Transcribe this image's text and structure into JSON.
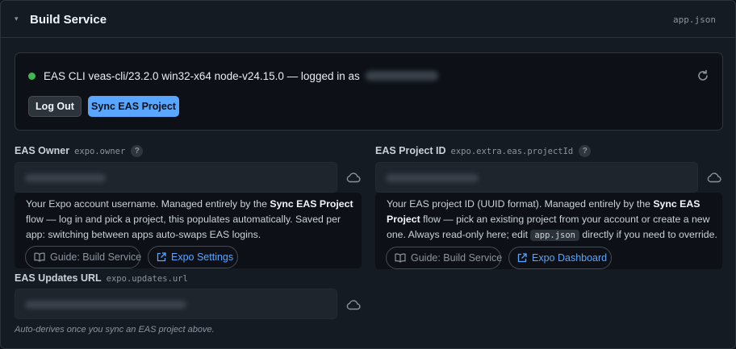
{
  "section": {
    "caret": "▾",
    "title": "Build Service",
    "file_tag": "app.json"
  },
  "cli": {
    "status_text": "EAS CLI veas-cli/23.2.0 win32-x64 node-v24.15.0 — logged in as",
    "logout_label": "Log Out",
    "sync_label": "Sync EAS Project"
  },
  "owner": {
    "label": "EAS Owner",
    "code": "expo.owner",
    "help": "?",
    "desc_pre": "Your Expo account username. Managed entirely by the ",
    "desc_bold": "Sync EAS Project",
    "desc_post": " flow — log in and pick a project, this populates automatically. Saved per app: switching between apps auto-swaps EAS logins.",
    "guide_label": "Guide: Build Service",
    "ext_label": "Expo Settings"
  },
  "project": {
    "label": "EAS Project ID",
    "code": "expo.extra.eas.projectId",
    "help": "?",
    "desc_pre": "Your EAS project ID (UUID format). Managed entirely by the ",
    "desc_bold": "Sync EAS Project",
    "desc_mid": " flow — pick an existing project from your account or create a new one. Always read-only here; edit ",
    "desc_code": "app.json",
    "desc_post": " directly if you need to override.",
    "guide_label": "Guide: Build Service",
    "ext_label": "Expo Dashboard"
  },
  "updates": {
    "label": "EAS Updates URL",
    "code": "expo.updates.url",
    "hint": "Auto-derives once you sync an EAS project above."
  },
  "colors": {
    "status_ok": "#3fb950",
    "accent": "#58a6ff",
    "panel_bg": "#151b23"
  },
  "icons": [
    "chevron-down-icon",
    "refresh-icon",
    "cloud-icon",
    "book-icon",
    "external-link-icon",
    "help-icon"
  ]
}
